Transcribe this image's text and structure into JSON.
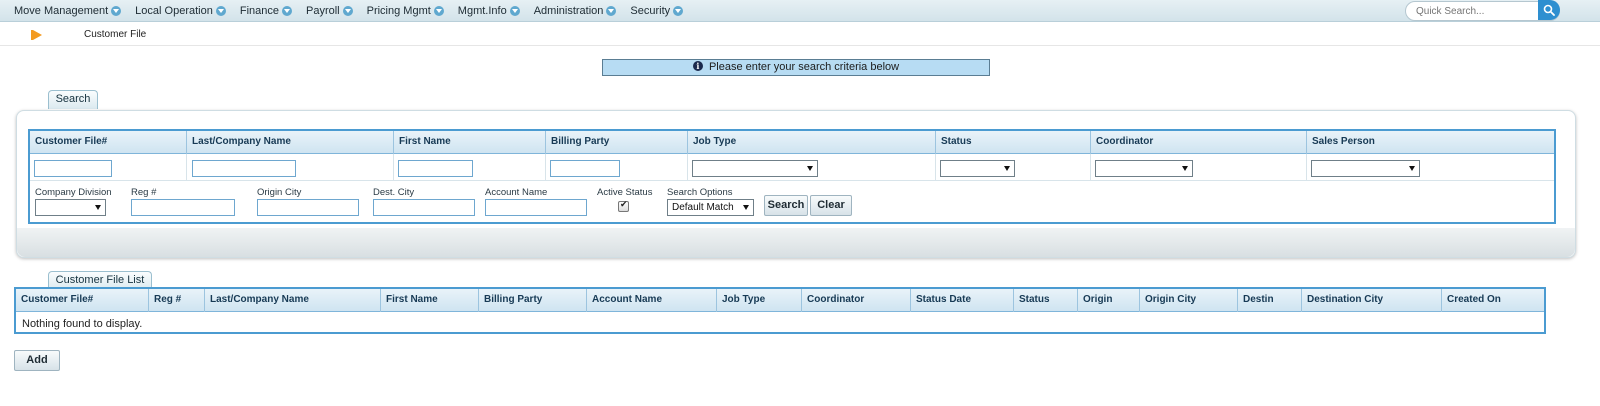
{
  "nav": {
    "menus": [
      "Move Management",
      "Local Operation",
      "Finance",
      "Payroll",
      "Pricing Mgmt",
      "Mgmt.Info",
      "Administration",
      "Security"
    ],
    "quick_search_placeholder": "Quick Search..."
  },
  "breadcrumb": {
    "current": "Customer File"
  },
  "info_message": "Please enter your search criteria below",
  "search": {
    "tab_label": "Search",
    "columns": [
      "Customer File#",
      "Last/Company Name",
      "First Name",
      "Billing Party",
      "Job Type",
      "Status",
      "Coordinator",
      "Sales Person"
    ],
    "labels": {
      "company_division": "Company Division",
      "reg": "Reg #",
      "origin_city": "Origin City",
      "dest_city": "Dest. City",
      "account_name": "Account Name",
      "active_status": "Active Status",
      "search_options": "Search Options"
    },
    "search_options_value": "Default Match",
    "active_status_checked": true,
    "search_button": "Search",
    "clear_button": "Clear"
  },
  "results": {
    "tab_label": "Customer File List",
    "columns": [
      "Customer File#",
      "Reg #",
      "Last/Company Name",
      "First Name",
      "Billing Party",
      "Account Name",
      "Job Type",
      "Coordinator",
      "Status Date",
      "Status",
      "Origin",
      "Origin City",
      "Destin",
      "Destination City",
      "Created On"
    ],
    "empty_message": "Nothing found to display."
  },
  "add_button": "Add"
}
